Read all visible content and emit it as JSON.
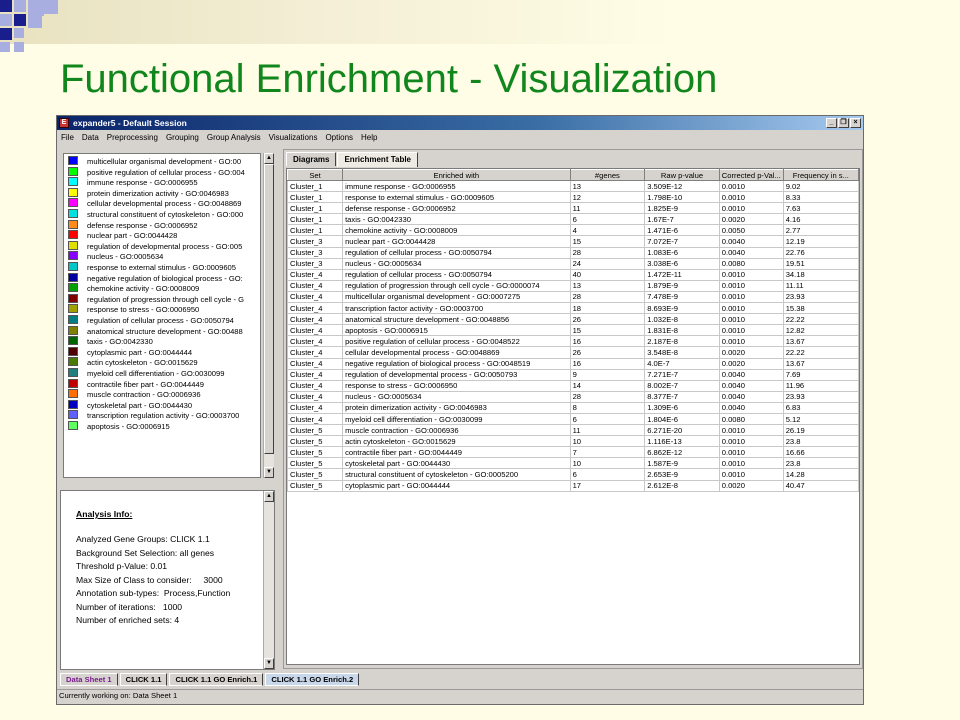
{
  "slide": {
    "title": "Functional Enrichment - Visualization"
  },
  "colors": {
    "title_green": "#10861c",
    "square_dark": "#1a1d8c",
    "square_light": "#a8aee0",
    "slide_bg": "#fffde6"
  },
  "window": {
    "title": "expander5 - Default Session",
    "app_icon": "E",
    "controls": [
      "_",
      "❐",
      "×"
    ]
  },
  "menu": [
    "File",
    "Data",
    "Preprocessing",
    "Grouping",
    "Group Analysis",
    "Visualizations",
    "Options",
    "Help"
  ],
  "legend": [
    {
      "label": "multicellular organismal development - GO:00",
      "color": "#0000ff"
    },
    {
      "label": "positive regulation of cellular process - GO:004",
      "color": "#00ff00"
    },
    {
      "label": "immune response - GO:0006955",
      "color": "#00ffff"
    },
    {
      "label": "protein dimerization activity - GO:0046983",
      "color": "#ffff00"
    },
    {
      "label": "cellular developmental process - GO:0048869",
      "color": "#ff00ff"
    },
    {
      "label": "structural constituent of cytoskeleton - GO:000",
      "color": "#00e0e0"
    },
    {
      "label": "defense response - GO:0006952",
      "color": "#ff8c1a"
    },
    {
      "label": "nuclear part - GO:0044428",
      "color": "#ff0000"
    },
    {
      "label": "regulation of developmental process - GO:005",
      "color": "#e0e000"
    },
    {
      "label": "nucleus - GO:0005634",
      "color": "#8800ff"
    },
    {
      "label": "response to external stimulus - GO:0009605",
      "color": "#00c8c8"
    },
    {
      "label": "negative regulation of biological process - GO:",
      "color": "#0000a0"
    },
    {
      "label": "chemokine activity - GO:0008009",
      "color": "#00a000"
    },
    {
      "label": "regulation of progression through cell cycle - G",
      "color": "#800000"
    },
    {
      "label": "response to stress - GO:0006950",
      "color": "#a0a000"
    },
    {
      "label": "regulation of cellular process - GO:0050794",
      "color": "#008080"
    },
    {
      "label": "anatomical structure development - GO:00488",
      "color": "#808000"
    },
    {
      "label": "taxis - GO:0042330",
      "color": "#006400"
    },
    {
      "label": "cytoplasmic part - GO:0044444",
      "color": "#500000"
    },
    {
      "label": "actin cytoskeleton - GO:0015629",
      "color": "#4a7a00"
    },
    {
      "label": "myeloid cell differentiation - GO:0030099",
      "color": "#208080"
    },
    {
      "label": "contractile fiber part - GO:0044449",
      "color": "#c00000"
    },
    {
      "label": "muscle contraction - GO:0006936",
      "color": "#ff7000"
    },
    {
      "label": "cytoskeletal part - GO:0044430",
      "color": "#0000c0"
    },
    {
      "label": "transcription regulation activity - GO:0003700",
      "color": "#6060ff"
    },
    {
      "label": "apoptosis - GO:0006915",
      "color": "#60ff60"
    }
  ],
  "analysis_info": {
    "heading": "Analysis Info:",
    "lines": [
      "Analyzed Gene Groups: CLICK 1.1",
      "Background Set Selection: all genes",
      "Threshold p-Value: 0.01",
      "Max Size of Class to consider:     3000",
      "Annotation sub-types:  Process,Function",
      "Number of iterations:   1000",
      "Number of enriched sets: 4"
    ]
  },
  "right_tabs": [
    {
      "label": "Diagrams",
      "active": false
    },
    {
      "label": "Enrichment Table",
      "active": true
    }
  ],
  "table": {
    "columns": [
      "Set",
      "Enriched with",
      "#genes",
      "Raw p-value",
      "Corrected p-Val...",
      "Frequency in s..."
    ],
    "rows": [
      [
        "Cluster_1",
        "immune response - GO:0006955",
        "13",
        "3.509E-12",
        "0.0010",
        "9.02"
      ],
      [
        "Cluster_1",
        "response to external stimulus - GO:0009605",
        "12",
        "1.798E-10",
        "0.0010",
        "8.33"
      ],
      [
        "Cluster_1",
        "defense response - GO:0006952",
        "11",
        "1.825E-9",
        "0.0010",
        "7.63"
      ],
      [
        "Cluster_1",
        "taxis - GO:0042330",
        "6",
        "1.67E-7",
        "0.0020",
        "4.16"
      ],
      [
        "Cluster_1",
        "chemokine activity - GO:0008009",
        "4",
        "1.471E-6",
        "0.0050",
        "2.77"
      ],
      [
        "Cluster_3",
        "nuclear part - GO:0044428",
        "15",
        "7.072E-7",
        "0.0040",
        "12.19"
      ],
      [
        "Cluster_3",
        "regulation of cellular process - GO:0050794",
        "28",
        "1.083E-6",
        "0.0040",
        "22.76"
      ],
      [
        "Cluster_3",
        "nucleus - GO:0005634",
        "24",
        "3.038E-6",
        "0.0080",
        "19.51"
      ],
      [
        "Cluster_4",
        "regulation of cellular process - GO:0050794",
        "40",
        "1.472E-11",
        "0.0010",
        "34.18"
      ],
      [
        "Cluster_4",
        "regulation of progression through cell cycle - GO:0000074",
        "13",
        "1.879E-9",
        "0.0010",
        "11.11"
      ],
      [
        "Cluster_4",
        "multicellular organismal development - GO:0007275",
        "28",
        "7.478E-9",
        "0.0010",
        "23.93"
      ],
      [
        "Cluster_4",
        "transcription factor activity - GO:0003700",
        "18",
        "8.693E-9",
        "0.0010",
        "15.38"
      ],
      [
        "Cluster_4",
        "anatomical structure development - GO:0048856",
        "26",
        "1.032E-8",
        "0.0010",
        "22.22"
      ],
      [
        "Cluster_4",
        "apoptosis - GO:0006915",
        "15",
        "1.831E-8",
        "0.0010",
        "12.82"
      ],
      [
        "Cluster_4",
        "positive regulation of cellular process - GO:0048522",
        "16",
        "2.187E-8",
        "0.0010",
        "13.67"
      ],
      [
        "Cluster_4",
        "cellular developmental process - GO:0048869",
        "26",
        "3.548E-8",
        "0.0020",
        "22.22"
      ],
      [
        "Cluster_4",
        "negative regulation of biological process - GO:0048519",
        "16",
        "4.0E-7",
        "0.0020",
        "13.67"
      ],
      [
        "Cluster_4",
        "regulation of developmental process - GO:0050793",
        "9",
        "7.271E-7",
        "0.0040",
        "7.69"
      ],
      [
        "Cluster_4",
        "response to stress - GO:0006950",
        "14",
        "8.002E-7",
        "0.0040",
        "11.96"
      ],
      [
        "Cluster_4",
        "nucleus - GO:0005634",
        "28",
        "8.377E-7",
        "0.0040",
        "23.93"
      ],
      [
        "Cluster_4",
        "protein dimerization activity - GO:0046983",
        "8",
        "1.309E-6",
        "0.0040",
        "6.83"
      ],
      [
        "Cluster_4",
        "myeloid cell differentiation - GO:0030099",
        "6",
        "1.804E-6",
        "0.0080",
        "5.12"
      ],
      [
        "Cluster_5",
        "muscle contraction - GO:0006936",
        "11",
        "6.271E-20",
        "0.0010",
        "26.19"
      ],
      [
        "Cluster_5",
        "actin cytoskeleton - GO:0015629",
        "10",
        "1.116E-13",
        "0.0010",
        "23.8"
      ],
      [
        "Cluster_5",
        "contractile fiber part - GO:0044449",
        "7",
        "6.862E-12",
        "0.0010",
        "16.66"
      ],
      [
        "Cluster_5",
        "cytoskeletal part - GO:0044430",
        "10",
        "1.587E-9",
        "0.0010",
        "23.8"
      ],
      [
        "Cluster_5",
        "structural constituent of cytoskeleton - GO:0005200",
        "6",
        "2.653E-9",
        "0.0010",
        "14.28"
      ],
      [
        "Cluster_5",
        "cytoplasmic part - GO:0044444",
        "17",
        "2.612E-8",
        "0.0020",
        "40.47"
      ]
    ]
  },
  "bottom_tabs": [
    {
      "label": "Data Sheet 1",
      "active": false
    },
    {
      "label": "CLICK 1.1",
      "active": false
    },
    {
      "label": "CLICK 1.1 GO Enrich.1",
      "active": false
    },
    {
      "label": "CLICK 1.1 GO Enrich.2",
      "active": true
    }
  ],
  "status": "Currently working on: Data Sheet 1"
}
